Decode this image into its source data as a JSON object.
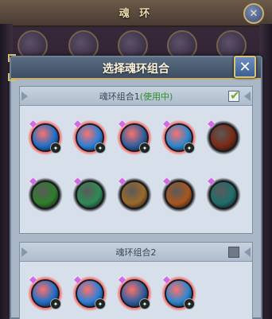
{
  "background": {
    "title": "魂 环",
    "close_glyph": "✕"
  },
  "dialog": {
    "title": "选择魂环组合",
    "close_glyph": "✕"
  },
  "combos": [
    {
      "name": "魂环组合1",
      "status": "(使用中)",
      "checked": true,
      "rings": [
        {
          "icon": "blue-water-ring-icon",
          "aura": "red",
          "core": "#1f6fc9"
        },
        {
          "icon": "blue-orb-ring-icon",
          "aura": "red",
          "core": "#2a7fd8"
        },
        {
          "icon": "blue-sword-ring-icon",
          "aura": "red",
          "core": "#2f5f9e"
        },
        {
          "icon": "blue-wave-ring-icon",
          "aura": "red",
          "core": "#2b86cf"
        },
        {
          "icon": "fire-beast-ring-icon",
          "aura": "black",
          "core": "#7a2a14"
        },
        {
          "icon": "green-leaf-ring-icon",
          "aura": "black",
          "core": "#2f7d2a"
        },
        {
          "icon": "green-wing-ring-icon",
          "aura": "black",
          "core": "#2e8a54"
        },
        {
          "icon": "golden-dragon-ring-icon",
          "aura": "black",
          "core": "#9a6a2a"
        },
        {
          "icon": "orange-beast-ring-icon",
          "aura": "black",
          "core": "#a8561e"
        },
        {
          "icon": "teal-spirit-ring-icon",
          "aura": "black",
          "core": "#1f6e6a"
        }
      ]
    },
    {
      "name": "魂环组合2",
      "status": "",
      "checked": false,
      "rings": [
        {
          "icon": "blue-water-ring-icon",
          "aura": "red",
          "core": "#1f6fc9"
        },
        {
          "icon": "blue-orb-ring-icon",
          "aura": "red",
          "core": "#2a7fd8"
        },
        {
          "icon": "blue-sword-ring-icon",
          "aura": "red",
          "core": "#2f5f9e"
        },
        {
          "icon": "blue-wave-ring-icon",
          "aura": "red",
          "core": "#2b86cf"
        }
      ]
    }
  ]
}
